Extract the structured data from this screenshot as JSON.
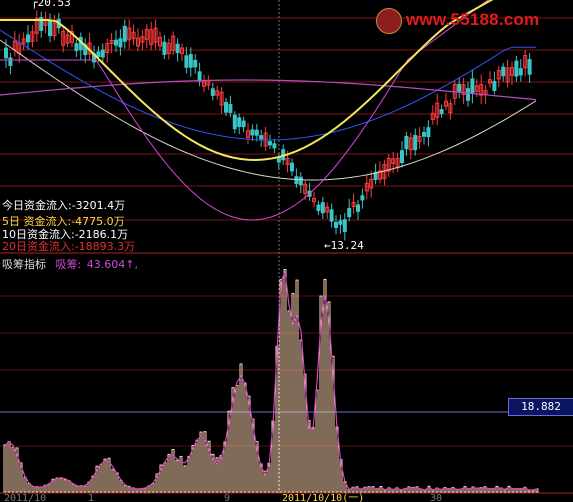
{
  "watermark": {
    "text": "www.55188.com"
  },
  "price_marker": {
    "low_label": "13.24",
    "top_label": "20.53"
  },
  "flows": [
    {
      "label": "今日资金流入",
      "value": "-3201.4万",
      "color": "#ffffff"
    },
    {
      "label": "5日 资金流入",
      "value": "-4775.0万",
      "color": "#ffd84a"
    },
    {
      "label": "10日资金流入",
      "value": "-2186.1万",
      "color": "#ffffff"
    },
    {
      "label": "20日资金流入",
      "value": "-18893.3万",
      "color": "#e03030"
    }
  ],
  "indicator": {
    "name": "吸筹指标",
    "series_label": "吸筹",
    "value": "43.604",
    "arrow": "↑",
    "axis_readout": "18.882"
  },
  "date_axis": {
    "labels": [
      "2011/10",
      "1",
      "9",
      "2011/10/10(一)",
      "30"
    ]
  },
  "colors": {
    "background": "#000000",
    "candle_up": "#ff3b3b",
    "candle_down": "#39c5c5",
    "ma_yellow": "#f3e65a",
    "ma_magenta": "#d24ad8",
    "ma_blue": "#2e55ff",
    "ma_white": "#d8d8c8",
    "grid_red": "#7a1414",
    "volume_bar": "#ffd6b0",
    "volume_line": "#d048c0"
  }
}
